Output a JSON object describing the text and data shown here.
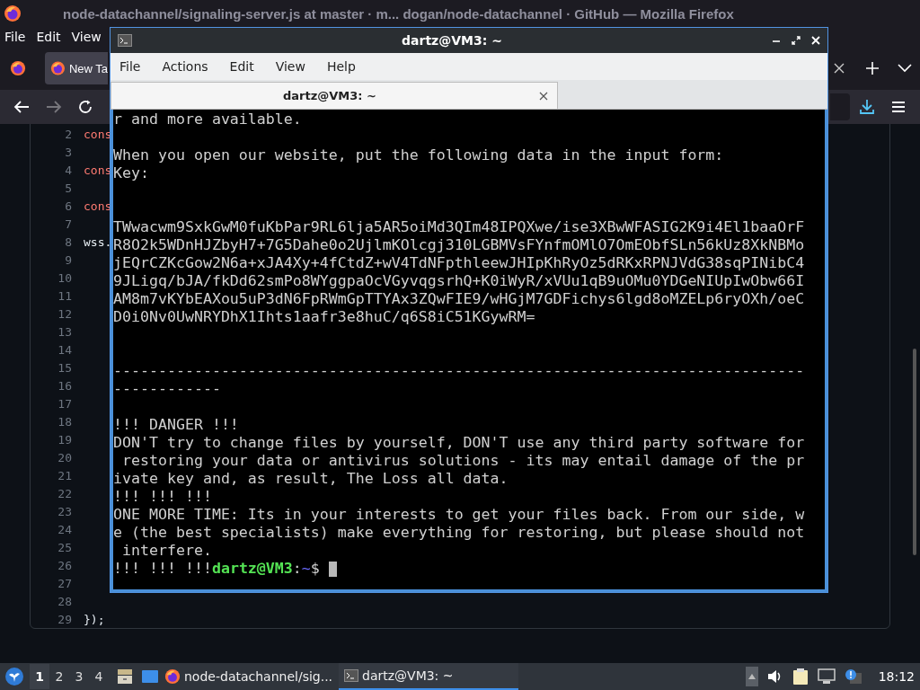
{
  "firefox": {
    "title": "node-datachannel/signaling-server.js at master · m...  dogan/node-datachannel · GitHub — Mozilla Firefox",
    "menu": [
      "File",
      "Edit",
      "View"
    ],
    "tab": {
      "label": "New Ta"
    },
    "editor": {
      "lines": [
        {
          "number": "2",
          "code": "cons",
          "kind": "keyword"
        },
        {
          "number": "3"
        },
        {
          "number": "4",
          "code": "cons",
          "kind": "keyword"
        },
        {
          "number": "5"
        },
        {
          "number": "6",
          "code": "cons",
          "kind": "keyword"
        },
        {
          "number": "7"
        },
        {
          "number": "8",
          "code": "wss.",
          "kind": "plain"
        },
        {
          "number": "9"
        },
        {
          "number": "10"
        },
        {
          "number": "11"
        },
        {
          "number": "12"
        },
        {
          "number": "13"
        },
        {
          "number": "14"
        },
        {
          "number": "15"
        },
        {
          "number": "16"
        },
        {
          "number": "17"
        },
        {
          "number": "18"
        },
        {
          "number": "19"
        },
        {
          "number": "20"
        },
        {
          "number": "21"
        },
        {
          "number": "22"
        },
        {
          "number": "23"
        },
        {
          "number": "24"
        },
        {
          "number": "25"
        },
        {
          "number": "26"
        },
        {
          "number": "27"
        },
        {
          "number": "28"
        },
        {
          "number": "29",
          "code": "});",
          "kind": "plain"
        }
      ]
    }
  },
  "terminal": {
    "title": "dartz@VM3: ~",
    "menu": [
      "File",
      "Actions",
      "Edit",
      "View",
      "Help"
    ],
    "tab": {
      "label": "dartz@VM3: ~"
    },
    "lines": [
      {
        "kind": "text",
        "text": "r and more available."
      },
      {
        "kind": "blank"
      },
      {
        "kind": "text",
        "text": "When you open our website, put the following data in the input form:"
      },
      {
        "kind": "text",
        "text": "Key:"
      },
      {
        "kind": "blank"
      },
      {
        "kind": "blank"
      },
      {
        "kind": "text",
        "text": "TWwacwm9SxkGwM0fuKbPar9RL6lja5AR5oiMd3QIm48IPQXwe/ise3XBwWFASIG2K9i4El1baaOrF"
      },
      {
        "kind": "text",
        "text": "R8O2k5WDnHJZbyH7+7G5Dahe0o2UjlmKOlcgj310LGBMVsFYnfmOMlO7OmEObfSLn56kUz8XkNBMo"
      },
      {
        "kind": "text",
        "text": "jEQrCZKcGow2N6a+xJA4Xy+4fCtdZ+wV4TdNFpthleewJHIpKhRyOz5dRKxRPNJVdG38sqPINibC4"
      },
      {
        "kind": "text",
        "text": "9JLigq/bJA/fkDd62smPo8WYggpaOcVGyvqgsrhQ+K0iWyR/xVUu1qB9uOMu0YDGeNIUpIwObw66I"
      },
      {
        "kind": "text",
        "text": "AM8m7vKYbEAXou5uP3dN6FpRWmGpTTYAx3ZQwFIE9/wHGjM7GDFichys6lgd8oMZELp6ryOXh/oeC"
      },
      {
        "kind": "text",
        "text": "D0i0Nv0UwNRYDhX1Ihts1aafr3e8huC/q6S8iC51KGywRM="
      },
      {
        "kind": "blank"
      },
      {
        "kind": "blank"
      },
      {
        "kind": "text",
        "text": "-----------------------------------------------------------------------------"
      },
      {
        "kind": "text",
        "text": "------------"
      },
      {
        "kind": "blank"
      },
      {
        "kind": "text",
        "text": "!!! DANGER !!!"
      },
      {
        "kind": "text",
        "text": "DON'T try to change files by yourself, DON'T use any third party software for"
      },
      {
        "kind": "text",
        "text": " restoring your data or antivirus solutions - its may entail damage of the pr"
      },
      {
        "kind": "text",
        "text": "ivate key and, as result, The Loss all data."
      },
      {
        "kind": "text",
        "text": "!!! !!! !!!"
      },
      {
        "kind": "text",
        "text": "ONE MORE TIME: Its in your interests to get your files back. From our side, w"
      },
      {
        "kind": "text",
        "text": "e (the best specialists) make everything for restoring, but please should not"
      },
      {
        "kind": "text",
        "text": " interfere."
      },
      {
        "kind": "prompt",
        "text": "!!! !!! !!!",
        "user_host": "dartz@VM3",
        "separator": ":",
        "path": "~",
        "symbol": "$"
      }
    ]
  },
  "taskbar": {
    "workspaces": [
      {
        "label": "1",
        "selected": true
      },
      {
        "label": "2",
        "selected": false
      },
      {
        "label": "3",
        "selected": false
      },
      {
        "label": "4",
        "selected": false
      }
    ],
    "tasks": [
      {
        "kind": "browser",
        "label": "node-datachannel/sig...",
        "selected": false
      },
      {
        "kind": "terminal",
        "label": "dartz@VM3: ~",
        "selected": true
      }
    ],
    "clock": "18:12"
  }
}
